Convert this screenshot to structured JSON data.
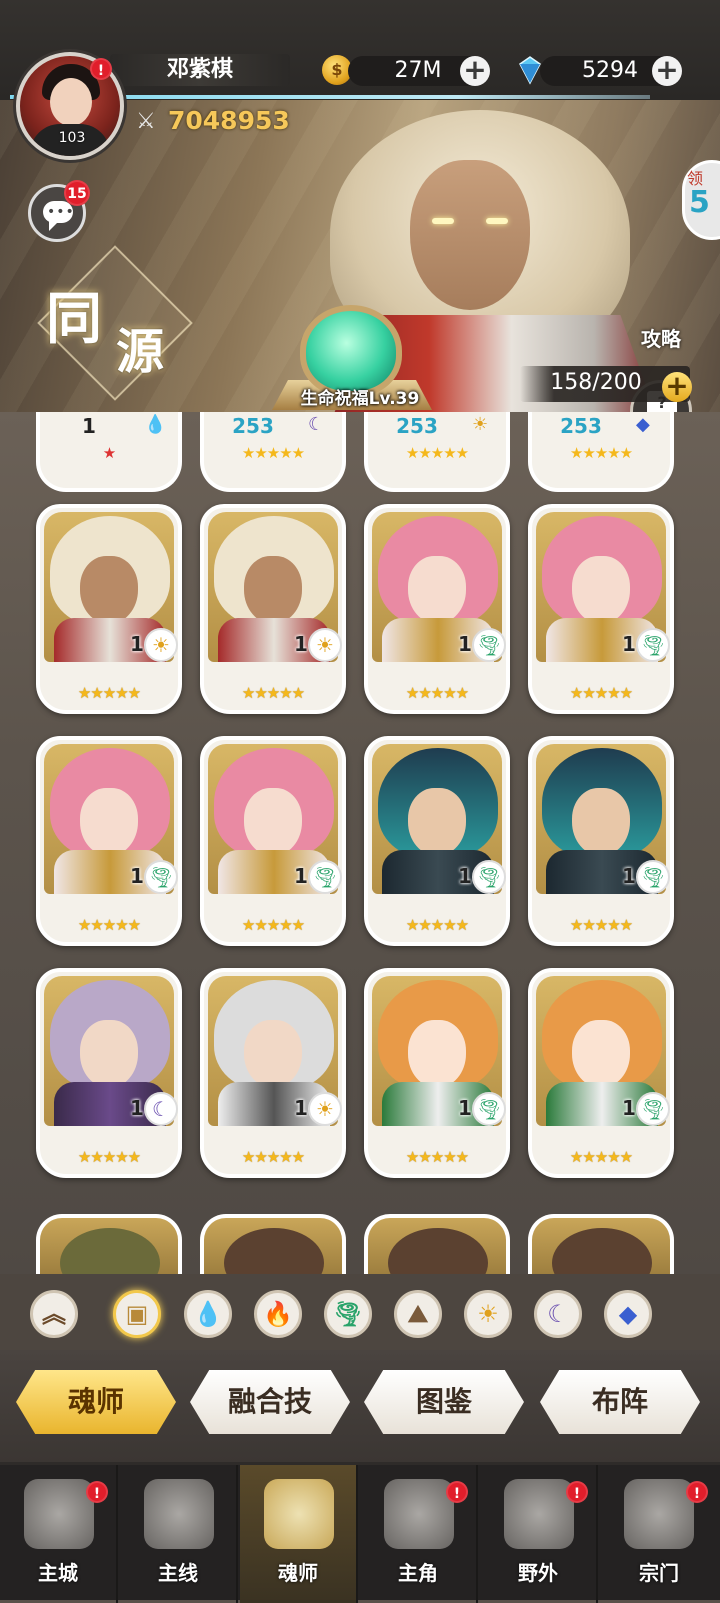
{
  "player": {
    "name": "邓紫棋",
    "level": "103",
    "power": "7048953",
    "avatar_badge": "!",
    "chat_badge": "15"
  },
  "resources": {
    "gold": "27M",
    "gems": "5294",
    "gold_icon": "coin-icon",
    "gem_icon": "diamond-icon"
  },
  "banner": {
    "origin_char_1": "同",
    "origin_char_2": "源",
    "blessing": "生命祝福Lv.39",
    "guide_label": "攻略",
    "card_count": "158/200",
    "side_gift_top": "领",
    "side_gift_num": "5"
  },
  "grid": {
    "top_partial": [
      {
        "level": "1",
        "stars": "★"
      },
      {
        "level": "253",
        "stars": "★★★★★"
      },
      {
        "level": "253",
        "stars": "★★★★★"
      },
      {
        "level": "253",
        "stars": "★★★★★"
      }
    ],
    "cards": [
      {
        "level": "1",
        "element": "☀",
        "stars": "★★★★★"
      },
      {
        "level": "1",
        "element": "☀",
        "stars": "★★★★★"
      },
      {
        "level": "1",
        "element": "🌪",
        "stars": "★★★★★"
      },
      {
        "level": "1",
        "element": "🌪",
        "stars": "★★★★★"
      },
      {
        "level": "1",
        "element": "🌪",
        "stars": "★★★★★"
      },
      {
        "level": "1",
        "element": "🌪",
        "stars": "★★★★★"
      },
      {
        "level": "1",
        "element": "🌪",
        "stars": "★★★★★"
      },
      {
        "level": "1",
        "element": "🌪",
        "stars": "★★★★★"
      },
      {
        "level": "1",
        "element": "☾",
        "stars": "★★★★★"
      },
      {
        "level": "1",
        "element": "☀",
        "stars": "★★★★★"
      },
      {
        "level": "1",
        "element": "🌪",
        "stars": "★★★★★"
      },
      {
        "level": "1",
        "element": "🌪",
        "stars": "★★★★★"
      }
    ]
  },
  "filters": [
    "︽",
    "▣",
    "💧",
    "🔥",
    "🌪",
    "⛰",
    "☀",
    "☾",
    "◆"
  ],
  "tabs": [
    "魂师",
    "融合技",
    "图鉴",
    "布阵"
  ],
  "nav": [
    {
      "label": "主城",
      "badge": "!"
    },
    {
      "label": "主线",
      "badge": ""
    },
    {
      "label": "魂师",
      "badge": ""
    },
    {
      "label": "主角",
      "badge": "!"
    },
    {
      "label": "野外",
      "badge": "!"
    },
    {
      "label": "宗门",
      "badge": "!"
    }
  ],
  "colors": {
    "accent_gold": "#f2c84b",
    "badge_red": "#e11e2b",
    "level_blue": "#2aa3c4"
  }
}
